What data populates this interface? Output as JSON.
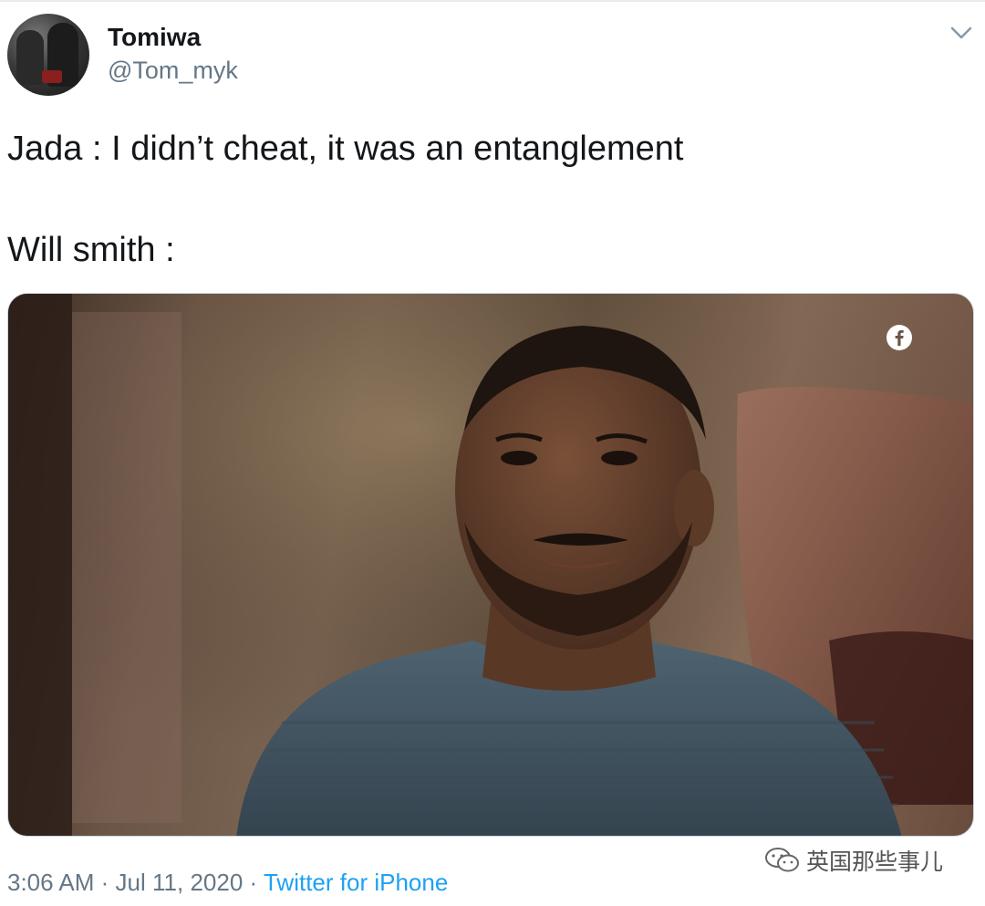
{
  "tweet": {
    "display_name": "Tomiwa",
    "handle": "@Tom_myk",
    "text_line_1": "Jada : I didn’t cheat, it was an entanglement",
    "text_line_2": "Will smith :",
    "time": "3:06 AM",
    "date": "Jul 11, 2020",
    "separator": "·",
    "source": "Twitter for iPhone"
  },
  "icons": {
    "options": "chevron-down-icon",
    "media_badge": "facebook-icon",
    "watermark": "wechat-icon"
  },
  "watermark_text": "英国那些事儿",
  "colors": {
    "text": "#14171a",
    "secondary": "#657786",
    "link": "#1da1f2"
  }
}
